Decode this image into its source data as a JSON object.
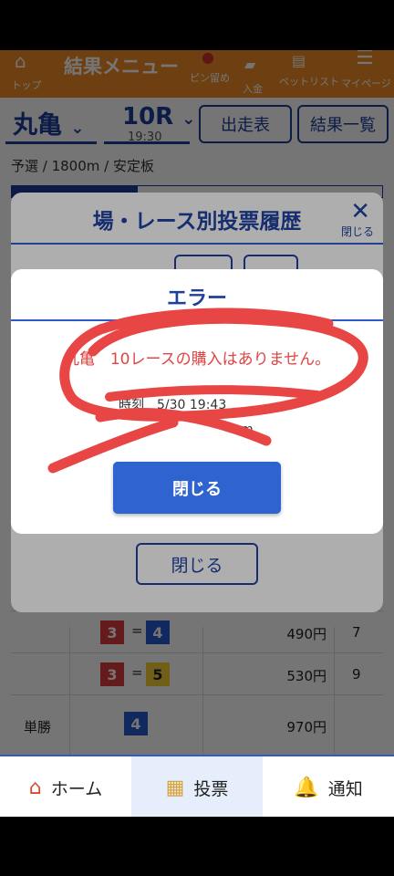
{
  "header": {
    "title": "結果メニュー",
    "items": [
      {
        "label": "トップ",
        "icon": "home-icon"
      },
      {
        "label": "ピン留め",
        "icon": "pin-icon"
      },
      {
        "label": "入金",
        "icon": "deposit-icon"
      },
      {
        "label": "ベットリスト",
        "icon": "betlist-icon"
      },
      {
        "label": "マイページ",
        "icon": "menu-icon"
      }
    ]
  },
  "race": {
    "venue": "丸亀",
    "race_no": "10R",
    "time": "19:30",
    "entries_button": "出走表",
    "results_button": "結果一覧",
    "info": "予選 / 1800m / 安定板"
  },
  "results": [
    {
      "type": "",
      "first": "3",
      "second": "4",
      "payout": "490円",
      "popularity": "7"
    },
    {
      "type": "",
      "first": "3",
      "second": "5",
      "payout": "530円",
      "popularity": "9"
    },
    {
      "type": "単勝",
      "first": "4",
      "second": "",
      "payout": "970円",
      "popularity": ""
    }
  ],
  "history_dialog": {
    "title": "場・レース別投票履歴",
    "close_icon_label": "閉じる",
    "close_button": "閉じる"
  },
  "error_dialog": {
    "title": "エラー",
    "message": "丸亀　10レースの購入はありません。",
    "partial_text_1": "時刻　5/30 19:43",
    "partial_text_2": "m",
    "close_button": "閉じる"
  },
  "bottom_nav": [
    {
      "label": "ホーム",
      "icon": "house-icon",
      "active": false
    },
    {
      "label": "投票",
      "icon": "ticket-icon",
      "active": true
    },
    {
      "label": "通知",
      "icon": "bell-icon",
      "active": false
    }
  ],
  "colors": {
    "header": "#f08a24",
    "primary": "#1f3f9a",
    "button": "#2f63d0",
    "error_text": "#e04444",
    "scribble": "#e84545"
  }
}
